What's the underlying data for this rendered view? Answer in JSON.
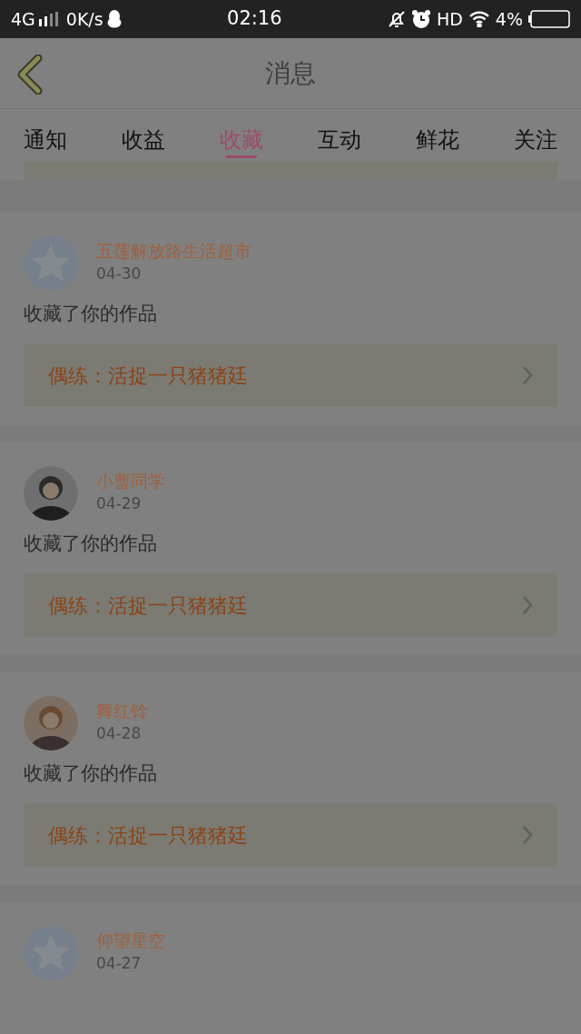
{
  "status_bar": {
    "network": "4G",
    "speed": "0K/s",
    "time": "02:16",
    "hd": "HD",
    "battery": "4%"
  },
  "header": {
    "title": "消息"
  },
  "tabs": [
    {
      "label": "通知",
      "selected": false
    },
    {
      "label": "收益",
      "selected": false
    },
    {
      "label": "收藏",
      "selected": true
    },
    {
      "label": "互动",
      "selected": false
    },
    {
      "label": "鲜花",
      "selected": false
    },
    {
      "label": "关注",
      "selected": false
    }
  ],
  "messages": [
    {
      "user": "五莲解放路生活超市",
      "date": "04-30",
      "avatar": {
        "kind": "default"
      },
      "text": "收藏了你的作品",
      "work": "偶练：活捉一只猪猪廷"
    },
    {
      "user": "小曹同学",
      "date": "04-29",
      "text": "收藏了你的作品",
      "work": "偶练：活捉一只猪猪廷"
    },
    {
      "user": "舞红铃",
      "date": "04-28",
      "text": "收藏了你的作品",
      "work": "偶练：活捉一只猪猪廷"
    },
    {
      "user": "仰望星空",
      "date": "04-27",
      "avatar": {
        "kind": "default"
      }
    }
  ]
}
